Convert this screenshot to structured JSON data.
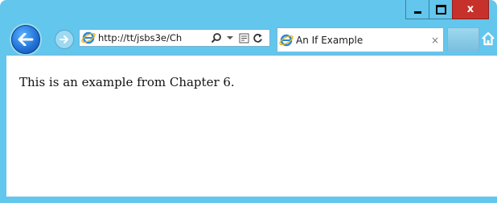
{
  "window": {
    "minimize_label": "",
    "maximize_label": "",
    "close_label": "x"
  },
  "toolbar": {
    "address_url": "http://tt/jsbs3e/Ch",
    "icons": [
      "back-icon",
      "forward-icon",
      "ie-icon",
      "search-icon",
      "dropdown-icon",
      "compatibility-icon",
      "refresh-icon",
      "home-icon"
    ]
  },
  "tab": {
    "title": "An If Example",
    "close_label": "×"
  },
  "page": {
    "text": "This is an example from Chapter 6."
  },
  "colors": {
    "frame": "#63c6ec",
    "close": "#c7312b",
    "back_button": "#1f6fd6"
  }
}
